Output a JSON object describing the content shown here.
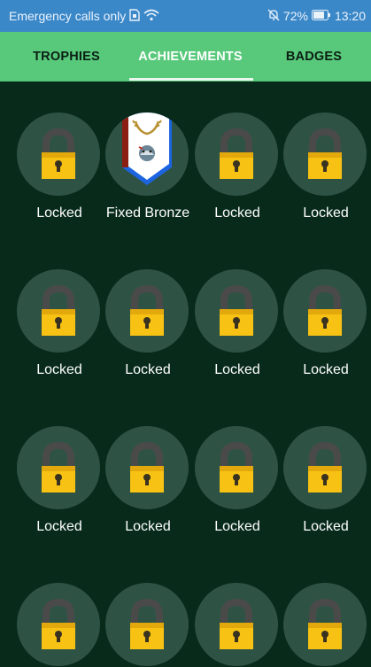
{
  "status_bar": {
    "carrier_text": "Emergency calls only",
    "battery": "72%",
    "time": "13:20",
    "icons": [
      "sim-icon",
      "wifi-icon",
      "mute-icon",
      "battery-icon"
    ]
  },
  "tabs": [
    {
      "label": "TROPHIES",
      "selected": false
    },
    {
      "label": "ACHIEVEMENTS",
      "selected": true
    },
    {
      "label": "BADGES",
      "selected": false
    }
  ],
  "achievements": [
    {
      "label": "Locked",
      "status": "locked"
    },
    {
      "label": "Fixed Bronze",
      "status": "unlocked"
    },
    {
      "label": "Locked",
      "status": "locked"
    },
    {
      "label": "Locked",
      "status": "locked"
    },
    {
      "label": "Locked",
      "status": "locked"
    },
    {
      "label": "Locked",
      "status": "locked"
    },
    {
      "label": "Locked",
      "status": "locked"
    },
    {
      "label": "Locked",
      "status": "locked"
    },
    {
      "label": "Locked",
      "status": "locked"
    },
    {
      "label": "Locked",
      "status": "locked"
    },
    {
      "label": "Locked",
      "status": "locked"
    },
    {
      "label": "Locked",
      "status": "locked"
    },
    {
      "label": "",
      "status": "locked"
    },
    {
      "label": "",
      "status": "locked"
    },
    {
      "label": "",
      "status": "locked"
    },
    {
      "label": "",
      "status": "locked"
    }
  ],
  "colors": {
    "status_bar": "#3b88c9",
    "tab_bar": "#58c97b",
    "background": "#072a1b",
    "circle": "#2e5345",
    "lock_body": "#f7c213",
    "lock_shackle": "#4a4a4a"
  }
}
